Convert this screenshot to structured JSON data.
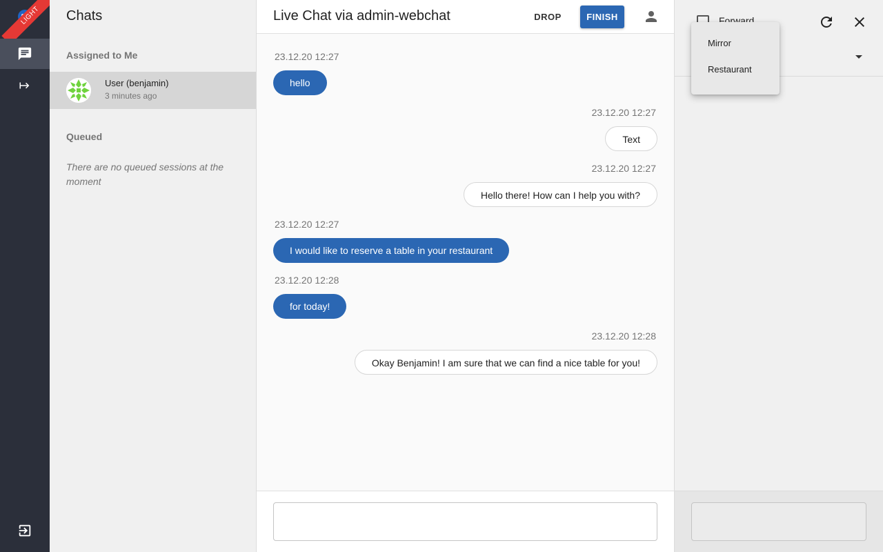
{
  "rail": {
    "badge": "LIGHT",
    "icons": [
      "chat-icon",
      "forward-icon",
      "logout-icon"
    ]
  },
  "sidebar": {
    "title": "Chats",
    "assigned_label": "Assigned to Me",
    "assigned": [
      {
        "name": "User (benjamin)",
        "time": "3 minutes ago"
      }
    ],
    "queued_label": "Queued",
    "queued_empty": "There are no queued sessions at the moment"
  },
  "chat": {
    "title": "Live Chat via admin-webchat",
    "drop_label": "DROP",
    "finish_label": "FINISH",
    "messages": [
      {
        "time": "23.12.20 12:27",
        "text": "hello",
        "side": "out"
      },
      {
        "time": "23.12.20 12:27",
        "text": "Text",
        "side": "in"
      },
      {
        "time": "23.12.20 12:27",
        "text": "Hello there! How can I help you with?",
        "side": "in"
      },
      {
        "time": "23.12.20 12:27",
        "text": "I would like to reserve a table in your restaurant",
        "side": "out"
      },
      {
        "time": "23.12.20 12:28",
        "text": "for today!",
        "side": "out"
      },
      {
        "time": "23.12.20 12:28",
        "text": "Okay Benjamin! I am sure that we can find a nice table for you!",
        "side": "in"
      }
    ],
    "composer_value": ""
  },
  "right_panel": {
    "checkbox_label": "Forward"
  },
  "dropdown": {
    "options": [
      "Mirror",
      "Restaurant"
    ]
  },
  "colors": {
    "accent": "#2b67b3",
    "rail": "#2b2f3a",
    "badge": "#e53935"
  }
}
